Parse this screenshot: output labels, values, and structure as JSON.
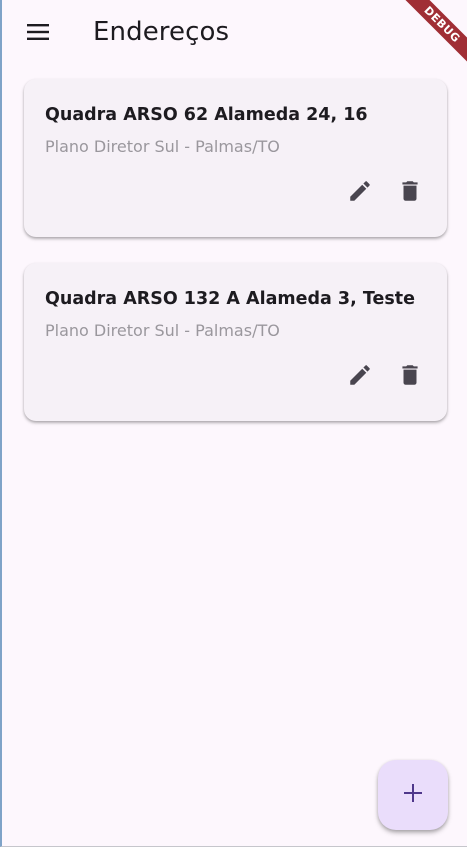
{
  "app": {
    "title": "Endereços",
    "debug_label": "DEBUG",
    "menu_icon": "menu-icon"
  },
  "addresses": [
    {
      "line1": "Quadra ARSO 62 Alameda 24, 16",
      "line2": "Plano Diretor Sul - Palmas/TO",
      "edit_icon": "edit-icon",
      "delete_icon": "delete-icon"
    },
    {
      "line1": "Quadra ARSO 132 A Alameda 3, Teste",
      "line2": "Plano Diretor Sul - Palmas/TO",
      "edit_icon": "edit-icon",
      "delete_icon": "delete-icon"
    }
  ],
  "fab": {
    "icon": "add-icon"
  },
  "colors": {
    "background": "#fdf7fd",
    "card": "#f6f1f7",
    "text": "#1d1b20",
    "subtitle": "#9a979d",
    "icon": "#49454f",
    "fab": "#eaddfb",
    "fab_icon": "#4f378b",
    "debug": "#a02e35"
  }
}
